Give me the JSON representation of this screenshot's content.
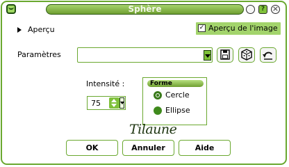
{
  "window": {
    "title": "Sphère"
  },
  "titlebar": {
    "help_glyph": "?",
    "close_glyph": "×"
  },
  "preview": {
    "label": "Aperçu"
  },
  "preview_image": {
    "label": "Aperçu de l'image",
    "checked": true,
    "check_glyph": "✓"
  },
  "params": {
    "label": "Paramètres",
    "value": ""
  },
  "intensity": {
    "label": "Intensité :",
    "value": "75"
  },
  "forme": {
    "title": "Forme",
    "options": [
      {
        "label": "Cercle",
        "selected": true
      },
      {
        "label": "Ellipse",
        "selected": false
      }
    ]
  },
  "signature": "Tilaune",
  "buttons": {
    "ok": "OK",
    "cancel": "Annuler",
    "help": "Aide"
  },
  "colors": {
    "accent": "#6aa82f",
    "title_green": "#8fc25a",
    "highlight": "#a3d46c"
  }
}
